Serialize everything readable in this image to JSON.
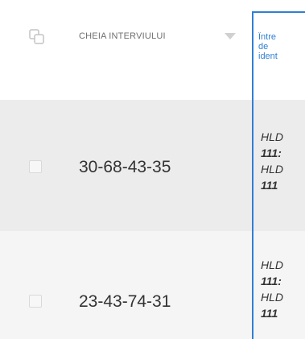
{
  "table": {
    "header": {
      "interview_key_label": "CHEIA INTERVIULUI",
      "question_label": "Între\nde\nident"
    },
    "rows": [
      {
        "key": "30-68-43-35",
        "answer_lines": [
          "HLD",
          "111:",
          "HLD",
          "111"
        ]
      },
      {
        "key": "23-43-74-31",
        "answer_lines": [
          "HLD",
          "111:",
          "HLD",
          "111"
        ]
      }
    ]
  },
  "colors": {
    "accent": "#2f7fd4",
    "row_selected_bg": "#ececec",
    "row_bg": "#f5f5f5"
  }
}
